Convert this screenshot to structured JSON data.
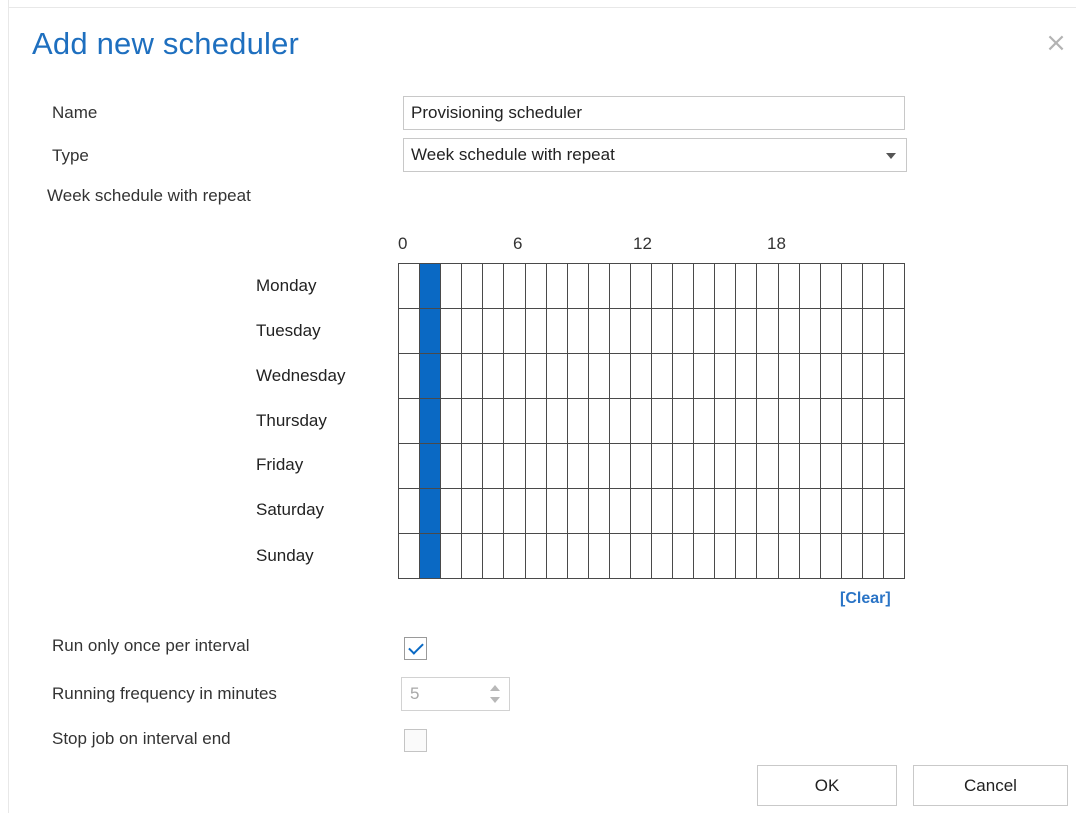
{
  "dialog": {
    "title": "Add new scheduler",
    "close_symbol": "×"
  },
  "form": {
    "name_label": "Name",
    "name_value": "Provisioning scheduler",
    "type_label": "Type",
    "type_value": "Week schedule with repeat",
    "schedule_label": "Week schedule with repeat"
  },
  "schedule": {
    "hour_labels": [
      "0",
      "6",
      "12",
      "18"
    ],
    "days": [
      "Monday",
      "Tuesday",
      "Wednesday",
      "Thursday",
      "Friday",
      "Saturday",
      "Sunday"
    ],
    "hours_per_day": 24,
    "selected_hours": [
      1
    ],
    "selected_color": "#0a69c4",
    "clear_label": "[Clear]"
  },
  "options": {
    "run_once_label": "Run only once per interval",
    "run_once_checked": true,
    "frequency_label": "Running frequency in minutes",
    "frequency_value": "5",
    "stop_job_label": "Stop job on interval end",
    "stop_job_checked": false
  },
  "buttons": {
    "ok_label": "OK",
    "cancel_label": "Cancel"
  },
  "colors": {
    "title": "#1e6fbf",
    "link": "#2a74c6"
  }
}
